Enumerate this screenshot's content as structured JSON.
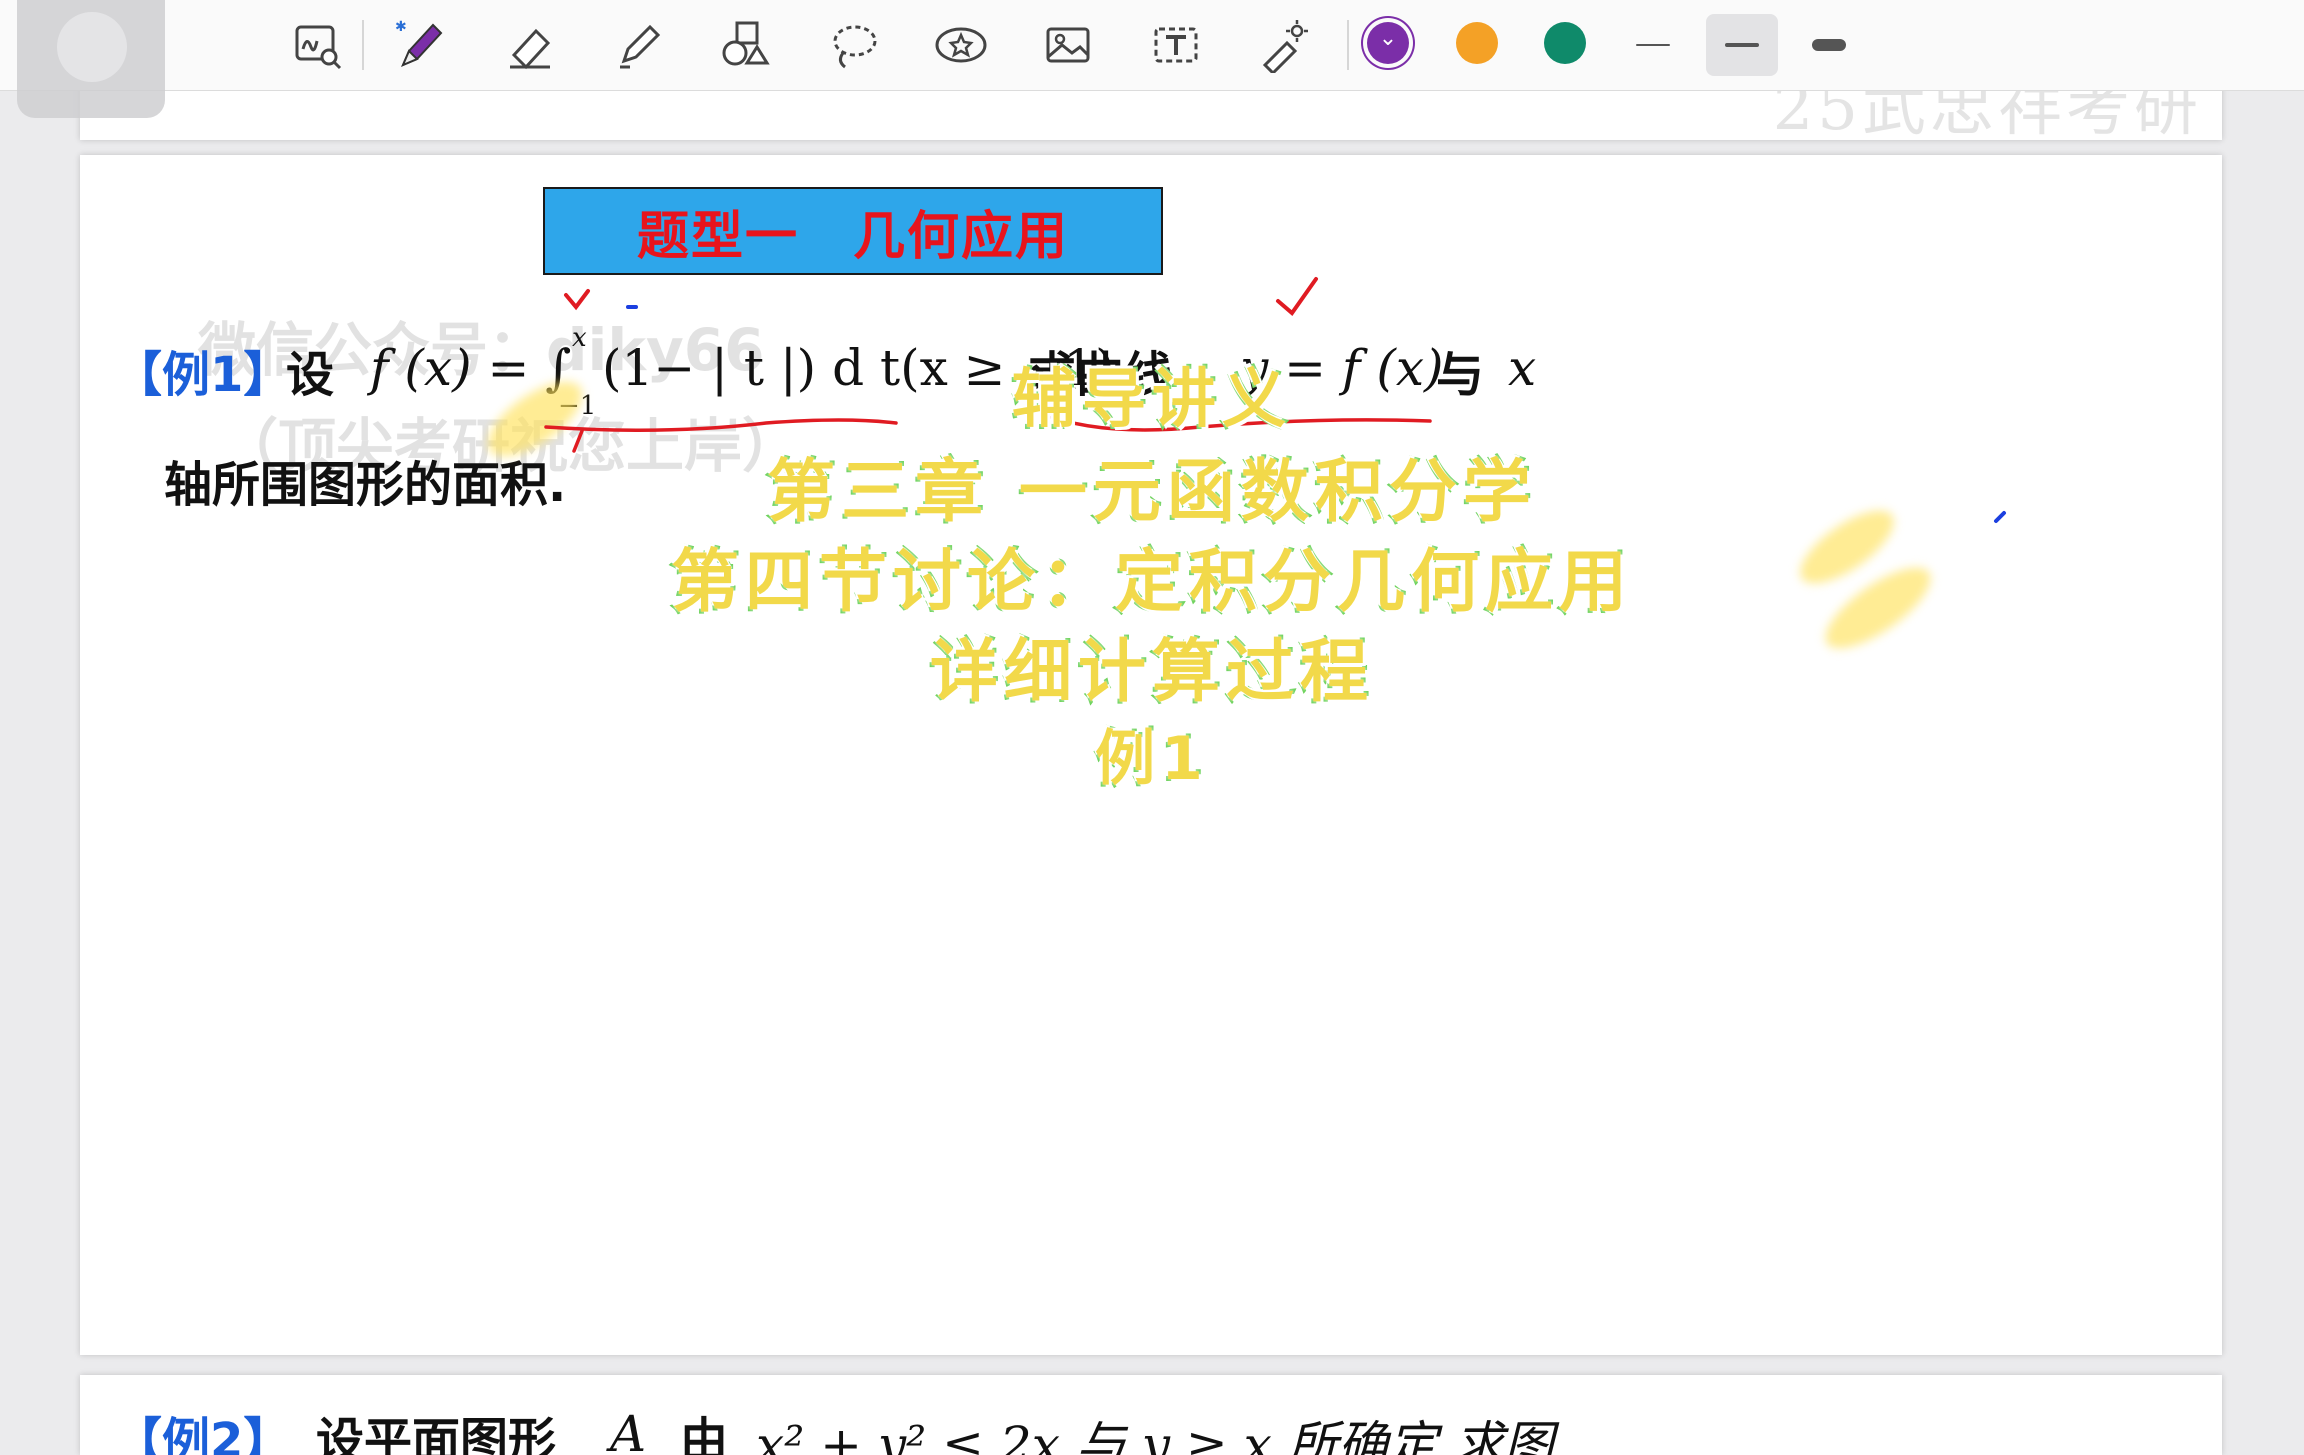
{
  "toolbar": {
    "tools": [
      {
        "name": "handwriting-zoom-icon"
      },
      {
        "name": "pen-icon"
      },
      {
        "name": "eraser-icon"
      },
      {
        "name": "highlighter-icon"
      },
      {
        "name": "shapes-icon"
      },
      {
        "name": "lasso-icon"
      },
      {
        "name": "sticker-icon"
      },
      {
        "name": "image-icon"
      },
      {
        "name": "text-box-icon"
      },
      {
        "name": "laser-pointer-icon"
      }
    ],
    "colors": [
      "#7b2ea8",
      "#f4a126",
      "#0f8a6a"
    ],
    "selected_color": "#7b2ea8",
    "stroke_widths": [
      "thin",
      "medium",
      "thick"
    ],
    "selected_stroke": "medium"
  },
  "page_prev": {
    "ghost_text": "25武忠祥考研"
  },
  "main": {
    "banner": "题型一　几何应用",
    "example1": {
      "label": "【例1】",
      "intro": "设",
      "formula_lhs": "f (x) = ∫",
      "upper": "x",
      "lower": "−1",
      "integrand": "(1− | t |) d t(x ≥ −1),",
      "ask_start": "求曲线",
      "ask_fx": "y = f (x)",
      "ask_with": "与",
      "ask_x": "x",
      "line2": "轴所围图形的面积."
    },
    "watermark": {
      "line1": "微信公众号：diky66",
      "line2": "（顶尖考研祝您上岸）"
    }
  },
  "overlay": {
    "line1": "辅导讲义",
    "line2": "第三章 一元函数积分学",
    "line3": "第四节讨论：定积分几何应用",
    "line4": "详细计算过程",
    "line5": "例1"
  },
  "example2": {
    "label": "【例2】",
    "text": "设平面图形",
    "A": "A",
    "by": "由",
    "cond": "x² + y² ≤ 2x 与 y ≥ x 所确定,求图"
  }
}
